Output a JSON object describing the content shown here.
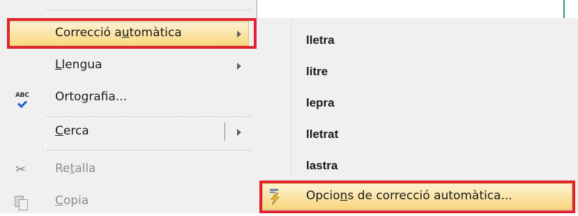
{
  "menu": {
    "items": [
      {
        "pre": "Correcció a",
        "ul": "u",
        "post": "tomàtica",
        "has_submenu": true,
        "highlighted": true
      },
      {
        "pre": "",
        "ul": "L",
        "post": "lengua",
        "has_submenu": true
      },
      {
        "pre": "Orto",
        "ul": "g",
        "post": "rafia...",
        "icon": "spellcheck-icon"
      },
      {
        "pre": "",
        "ul": "C",
        "post": "erca",
        "has_submenu": true,
        "split": true
      },
      {
        "pre": "Re",
        "ul": "t",
        "post": "alla",
        "icon": "scissors-icon",
        "disabled": true
      },
      {
        "pre": "",
        "ul": "C",
        "post": "opia",
        "icon": "copy-icon",
        "disabled": true
      }
    ]
  },
  "submenu": {
    "suggestions": [
      "lletra",
      "litre",
      "lepra",
      "lletrat",
      "lastra"
    ],
    "options": {
      "pre": "Opcio",
      "ul": "n",
      "post": "s de correcció automàtica...",
      "icon": "autocorrect-lightning-icon"
    }
  },
  "colors": {
    "menu_bg": "#f0f0f0",
    "highlight": "#f8d77f",
    "annotation_red": "#e2232b"
  }
}
